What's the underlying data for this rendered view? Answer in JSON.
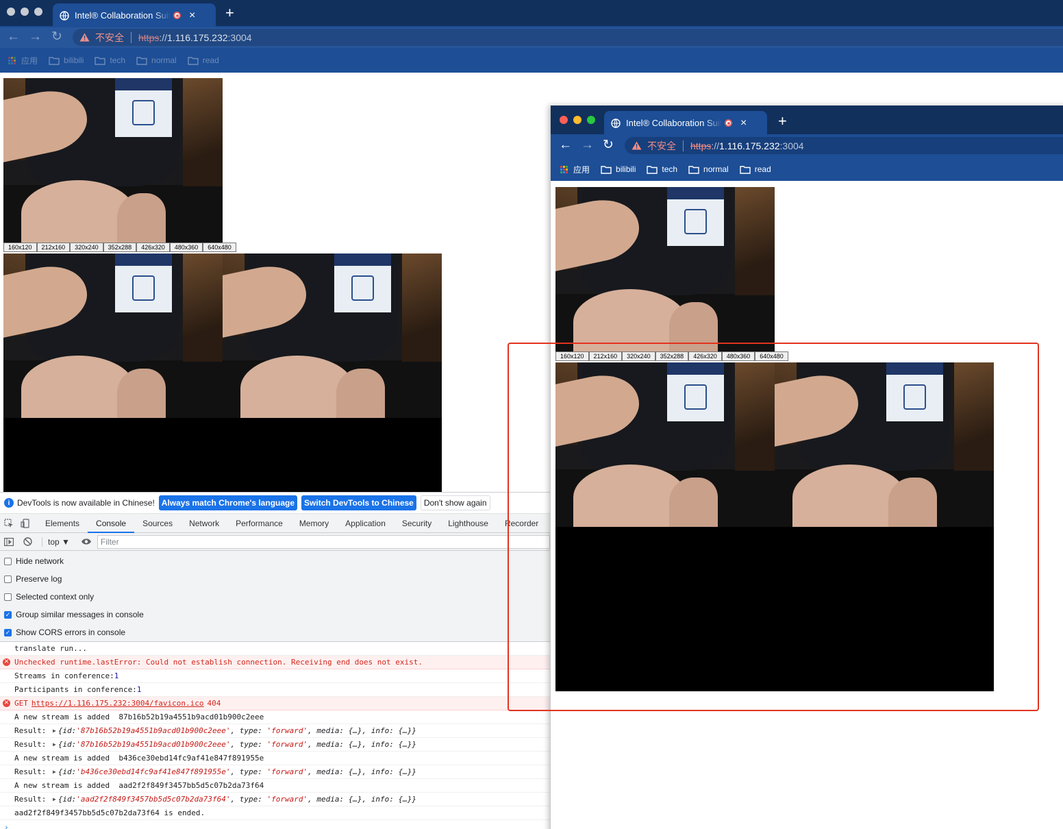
{
  "browser": {
    "tab_title": "Intel® Collaboration Suite for",
    "new_tab": "+",
    "close": "×",
    "insecure_label": "不安全",
    "url_scheme": "https",
    "url_sep": "://",
    "url_host": "1.116.175.232",
    "url_port": ":3004",
    "bookmarks": [
      "应用",
      "bilibili",
      "tech",
      "normal",
      "read"
    ]
  },
  "resolutions": [
    "160x120",
    "212x160",
    "320x240",
    "352x288",
    "426x320",
    "480x360",
    "640x480"
  ],
  "devtools": {
    "banner_text": "DevTools is now available in Chinese!",
    "banner_primary_1": "Always match Chrome's language",
    "banner_primary_2": "Switch DevTools to Chinese",
    "banner_secondary": "Don't show again",
    "tabs": [
      "Elements",
      "Console",
      "Sources",
      "Network",
      "Performance",
      "Memory",
      "Application",
      "Security",
      "Lighthouse",
      "Recorder"
    ],
    "context": "top ▼",
    "filter_placeholder": "Filter",
    "settings": [
      {
        "label": "Hide network",
        "checked": false
      },
      {
        "label": "Preserve log",
        "checked": false
      },
      {
        "label": "Selected context only",
        "checked": false
      },
      {
        "label": "Group similar messages in console",
        "checked": true
      },
      {
        "label": "Show CORS errors in console",
        "checked": true
      }
    ],
    "console": {
      "l1": "translate run...",
      "l2": "Unchecked runtime.lastError: Could not establish connection. Receiving end does not exist.",
      "l3_text": "Streams in conference: ",
      "l3_num": "1",
      "l4_text": "Participants in conference: ",
      "l4_num": "1",
      "l5_get": "GET",
      "l5_url": "https://1.116.175.232:3004/favicon.ico",
      "l5_code": "404",
      "l6": "A new stream is added  87b16b52b19a4551b9acd01b900c2eee",
      "result_prefix": "Result: ",
      "l7_open": "{id: ",
      "l7_id": "'87b16b52b19a4551b9acd01b900c2eee'",
      "type_part": ", type: ",
      "type_val": "'forward'",
      "tail": ", media: {…}, info: {…}}",
      "l9": "A new stream is added  b436ce30ebd14fc9af41e847f891955e",
      "l10_id": "'b436ce30ebd14fc9af41e847f891955e'",
      "l11": "A new stream is added  aad2f2f849f3457bb5d5c07b2da73f64",
      "l12_id": "'aad2f2f849f3457bb5d5c07b2da73f64'",
      "l13": "aad2f2f849f3457bb5d5c07b2da73f64 is ended.",
      "caret": "›"
    }
  },
  "colors": {
    "tabstrip": "#12305c",
    "toolbar": "#1d4e96",
    "highlight": "#e2331f",
    "accent": "#1a73e8"
  }
}
